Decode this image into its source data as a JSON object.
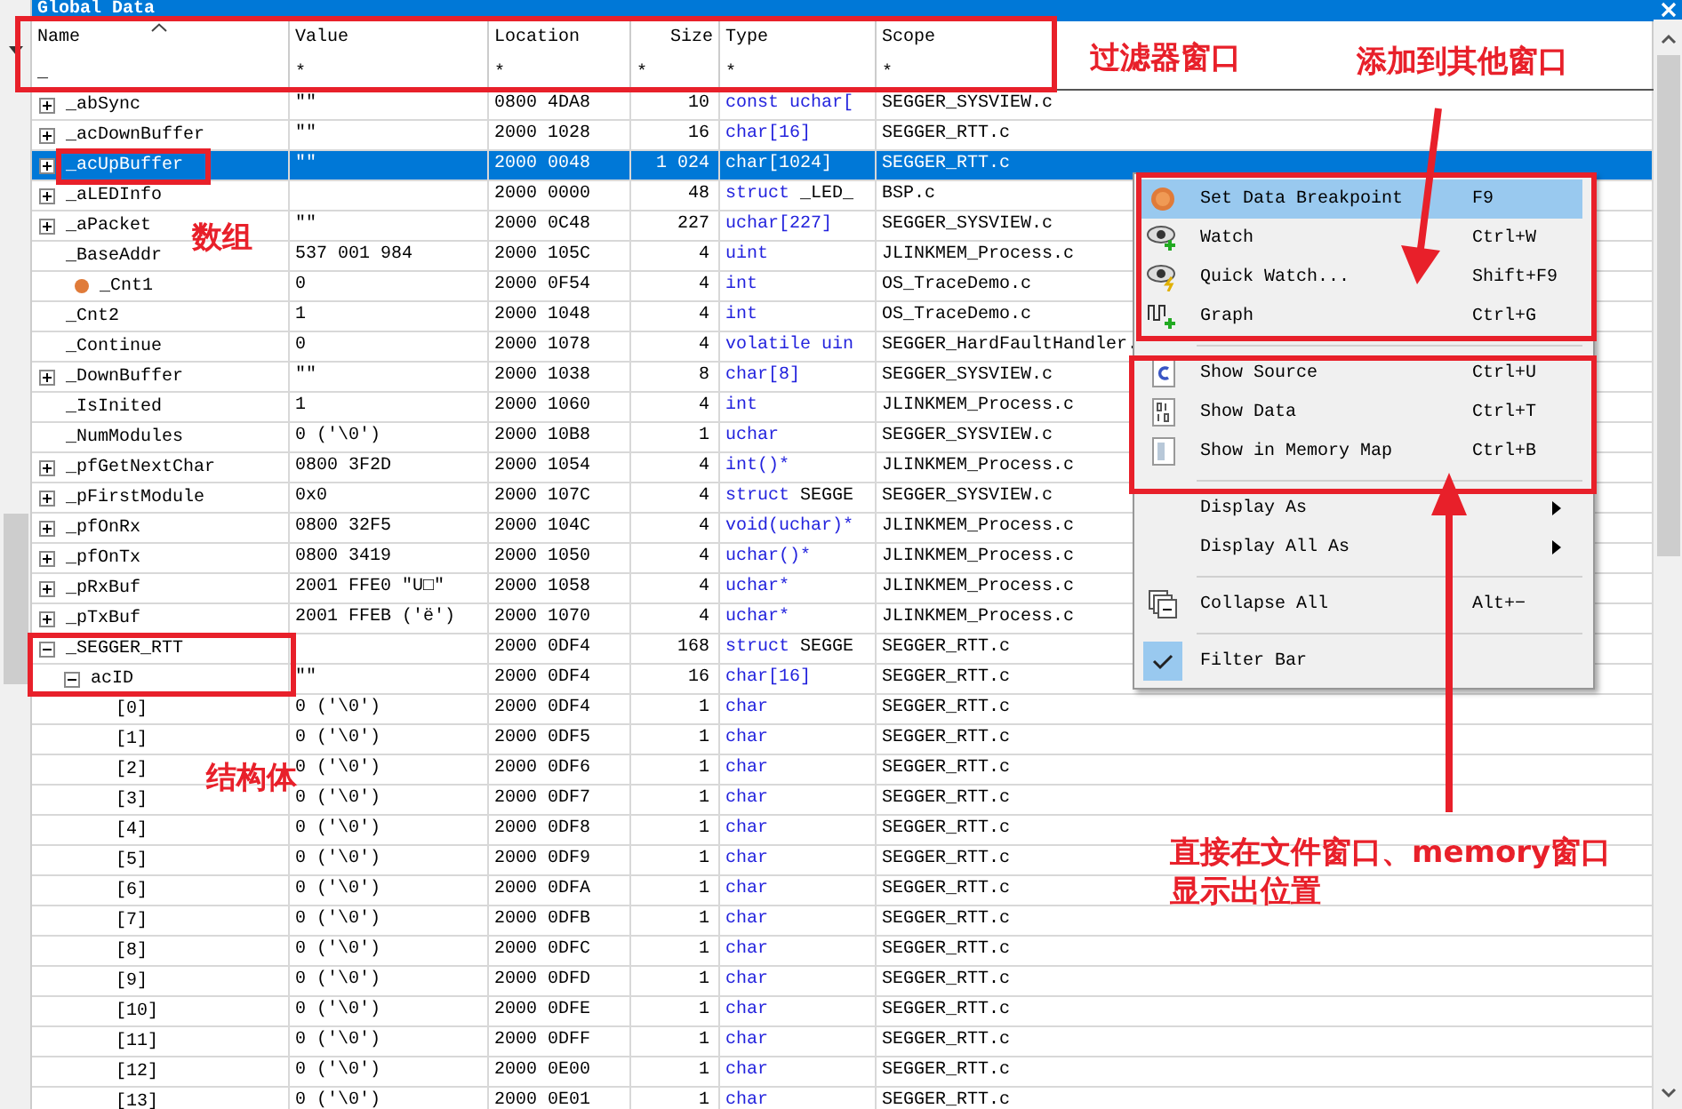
{
  "window": {
    "title": "Global Data"
  },
  "table": {
    "columns": [
      {
        "label": "Name",
        "filter": "_",
        "sorted": true
      },
      {
        "label": "Value",
        "filter": "*"
      },
      {
        "label": "Location",
        "filter": "*"
      },
      {
        "label": "Size",
        "filter": "*"
      },
      {
        "label": "Type",
        "filter": "*"
      },
      {
        "label": "Scope",
        "filter": "*"
      }
    ],
    "rows": [
      {
        "name": "_abSync",
        "value": "\"\"",
        "location": "0800 4DA8",
        "size": "10",
        "type": "const uchar[",
        "scope": "SEGGER_SYSVIEW.c",
        "expanded": false,
        "selected": false
      },
      {
        "name": "_acDownBuffer",
        "value": "\"\"",
        "location": "2000 1028",
        "size": "16",
        "type": "char[16]",
        "scope": "SEGGER_RTT.c",
        "expanded": false,
        "selected": false
      },
      {
        "name": "_acUpBuffer",
        "value": "\"\"",
        "location": "2000 0048",
        "size": "1 024",
        "type": "char[1024]",
        "scope": "SEGGER_RTT.c",
        "expanded": false,
        "selected": true
      },
      {
        "name": "_aLEDInfo",
        "location": "2000 0000",
        "size": "48",
        "type": "struct",
        "type_name": "_LED_",
        "scope": "BSP.c",
        "expanded": false,
        "selected": false
      },
      {
        "name": "_aPacket",
        "value": "\"\"",
        "location": "2000 0C48",
        "size": "227",
        "type": "uchar[227]",
        "scope": "SEGGER_SYSVIEW.c",
        "expanded": false,
        "selected": false
      },
      {
        "name": "_BaseAddr",
        "value": "537 001 984",
        "location": "2000 105C",
        "size": "4",
        "type": "uint",
        "scope": "JLINKMEM_Process.c",
        "selected": false
      },
      {
        "name": "_Cnt1",
        "value": "0",
        "location": "2000 0F54",
        "size": "4",
        "type": "int",
        "scope": "OS_TraceDemo.c",
        "breakpoint": true,
        "selected": false
      },
      {
        "name": "_Cnt2",
        "value": "1",
        "location": "2000 1048",
        "size": "4",
        "type": "int",
        "scope": "OS_TraceDemo.c",
        "selected": false
      },
      {
        "name": "_Continue",
        "value": "0",
        "location": "2000 1078",
        "size": "4",
        "type": "volatile uin",
        "scope": "SEGGER_HardFaultHandler.",
        "selected": false
      },
      {
        "name": "_DownBuffer",
        "value": "\"\"",
        "location": "2000 1038",
        "size": "8",
        "type": "char[8]",
        "scope": "SEGGER_SYSVIEW.c",
        "expanded": false,
        "selected": false
      },
      {
        "name": "_IsInited",
        "value": "1",
        "location": "2000 1060",
        "size": "4",
        "type": "int",
        "scope": "JLINKMEM_Process.c",
        "selected": false
      },
      {
        "name": "_NumModules",
        "value": "0 ('\\0')",
        "location": "2000 10B8",
        "size": "1",
        "type": "uchar",
        "scope": "SEGGER_SYSVIEW.c",
        "selected": false
      },
      {
        "name": "_pfGetNextChar",
        "value": "0800 3F2D",
        "location": "2000 1054",
        "size": "4",
        "type": "int()*",
        "scope": "JLINKMEM_Process.c",
        "expanded": false,
        "selected": false
      },
      {
        "name": "_pFirstModule",
        "value": "0x0",
        "location": "2000 107C",
        "size": "4",
        "type": "struct",
        "type_name": "SEGGE",
        "scope": "SEGGER_SYSVIEW.c",
        "expanded": false,
        "selected": false
      },
      {
        "name": "_pfOnRx",
        "value": "0800 32F5",
        "location": "2000 104C",
        "size": "4",
        "type": "void(uchar)*",
        "scope": "JLINKMEM_Process.c",
        "expanded": false,
        "selected": false
      },
      {
        "name": "_pfOnTx",
        "value": "0800 3419",
        "location": "2000 1050",
        "size": "4",
        "type": "uchar()*",
        "scope": "JLINKMEM_Process.c",
        "expanded": false,
        "selected": false
      },
      {
        "name": "_pRxBuf",
        "value": "2001 FFE0 \"U□\"",
        "location": "2000 1058",
        "size": "4",
        "type": "uchar*",
        "scope": "JLINKMEM_Process.c",
        "expanded": false,
        "selected": false
      },
      {
        "name": "_pTxBuf",
        "value": "2001 FFEB ('ë')",
        "location": "2000 1070",
        "size": "4",
        "type": "uchar*",
        "scope": "JLINKMEM_Process.c",
        "expanded": false,
        "selected": false
      },
      {
        "name": "_SEGGER_RTT",
        "location": "2000 0DF4",
        "size": "168",
        "type": "struct",
        "type_name": "SEGGE",
        "scope": "SEGGER_RTT.c",
        "expanded": true,
        "selected": false,
        "children": [
          {
            "name": "acID",
            "value": "\"\"",
            "location": "2000 0DF4",
            "size": "16",
            "type": "char[16]",
            "scope": "SEGGER_RTT.c",
            "expanded": true,
            "selected": false,
            "children": [
              {
                "name": "[0]",
                "value": "0 ('\\0')",
                "location": "2000 0DF4",
                "size": "1",
                "type": "char",
                "scope": "SEGGER_RTT.c",
                "selected": false
              },
              {
                "name": "[1]",
                "value": "0 ('\\0')",
                "location": "2000 0DF5",
                "size": "1",
                "type": "char",
                "scope": "SEGGER_RTT.c",
                "selected": false
              },
              {
                "name": "[2]",
                "value": "0 ('\\0')",
                "location": "2000 0DF6",
                "size": "1",
                "type": "char",
                "scope": "SEGGER_RTT.c",
                "selected": false
              },
              {
                "name": "[3]",
                "value": "0 ('\\0')",
                "location": "2000 0DF7",
                "size": "1",
                "type": "char",
                "scope": "SEGGER_RTT.c",
                "selected": false
              },
              {
                "name": "[4]",
                "value": "0 ('\\0')",
                "location": "2000 0DF8",
                "size": "1",
                "type": "char",
                "scope": "SEGGER_RTT.c",
                "selected": false
              },
              {
                "name": "[5]",
                "value": "0 ('\\0')",
                "location": "2000 0DF9",
                "size": "1",
                "type": "char",
                "scope": "SEGGER_RTT.c",
                "selected": false
              },
              {
                "name": "[6]",
                "value": "0 ('\\0')",
                "location": "2000 0DFA",
                "size": "1",
                "type": "char",
                "scope": "SEGGER_RTT.c",
                "selected": false
              },
              {
                "name": "[7]",
                "value": "0 ('\\0')",
                "location": "2000 0DFB",
                "size": "1",
                "type": "char",
                "scope": "SEGGER_RTT.c",
                "selected": false
              },
              {
                "name": "[8]",
                "value": "0 ('\\0')",
                "location": "2000 0DFC",
                "size": "1",
                "type": "char",
                "scope": "SEGGER_RTT.c",
                "selected": false
              },
              {
                "name": "[9]",
                "value": "0 ('\\0')",
                "location": "2000 0DFD",
                "size": "1",
                "type": "char",
                "scope": "SEGGER_RTT.c",
                "selected": false
              },
              {
                "name": "[10]",
                "value": "0 ('\\0')",
                "location": "2000 0DFE",
                "size": "1",
                "type": "char",
                "scope": "SEGGER_RTT.c",
                "selected": false
              },
              {
                "name": "[11]",
                "value": "0 ('\\0')",
                "location": "2000 0DFF",
                "size": "1",
                "type": "char",
                "scope": "SEGGER_RTT.c",
                "selected": false
              },
              {
                "name": "[12]",
                "value": "0 ('\\0')",
                "location": "2000 0E00",
                "size": "1",
                "type": "char",
                "scope": "SEGGER_RTT.c",
                "selected": false
              },
              {
                "name": "[13]",
                "value": "0 ('\\0')",
                "location": "2000 0E01",
                "size": "1",
                "type": "char",
                "scope": "SEGGER_RTT.c",
                "selected": false
              }
            ]
          }
        ]
      }
    ]
  },
  "context_menu": {
    "items": [
      {
        "kind": "item",
        "label": "Set Data Breakpoint",
        "shortcut": "F9",
        "selected": true
      },
      {
        "kind": "item",
        "label": "Watch",
        "shortcut": "Ctrl+W",
        "selected": false
      },
      {
        "kind": "item",
        "label": "Quick Watch...",
        "shortcut": "Shift+F9",
        "selected": false
      },
      {
        "kind": "item",
        "label": "Graph",
        "shortcut": "Ctrl+G",
        "selected": false
      },
      {
        "kind": "separator"
      },
      {
        "kind": "item",
        "label": "Show Source",
        "shortcut": "Ctrl+U",
        "selected": false
      },
      {
        "kind": "item",
        "label": "Show Data",
        "shortcut": "Ctrl+T",
        "selected": false
      },
      {
        "kind": "item",
        "label": "Show in Memory Map",
        "shortcut": "Ctrl+B",
        "selected": false
      },
      {
        "kind": "separator"
      },
      {
        "kind": "submenu",
        "label": "Display As",
        "selected": false
      },
      {
        "kind": "submenu",
        "label": "Display All As",
        "selected": false
      },
      {
        "kind": "separator"
      },
      {
        "kind": "item",
        "label": "Collapse All",
        "shortcut": "Alt+−",
        "selected": false
      },
      {
        "kind": "separator"
      },
      {
        "kind": "toggle",
        "label": "Filter Bar",
        "checked": true,
        "selected": false
      }
    ]
  },
  "annotations": [
    {
      "lines": [
        "过滤器窗口"
      ]
    },
    {
      "lines": [
        "添加到其他窗口"
      ]
    },
    {
      "lines": [
        "数组"
      ]
    },
    {
      "lines": [
        "结构体"
      ]
    },
    {
      "lines": [
        "直接在文件窗口、memory窗口",
        "显示出位置"
      ]
    }
  ]
}
